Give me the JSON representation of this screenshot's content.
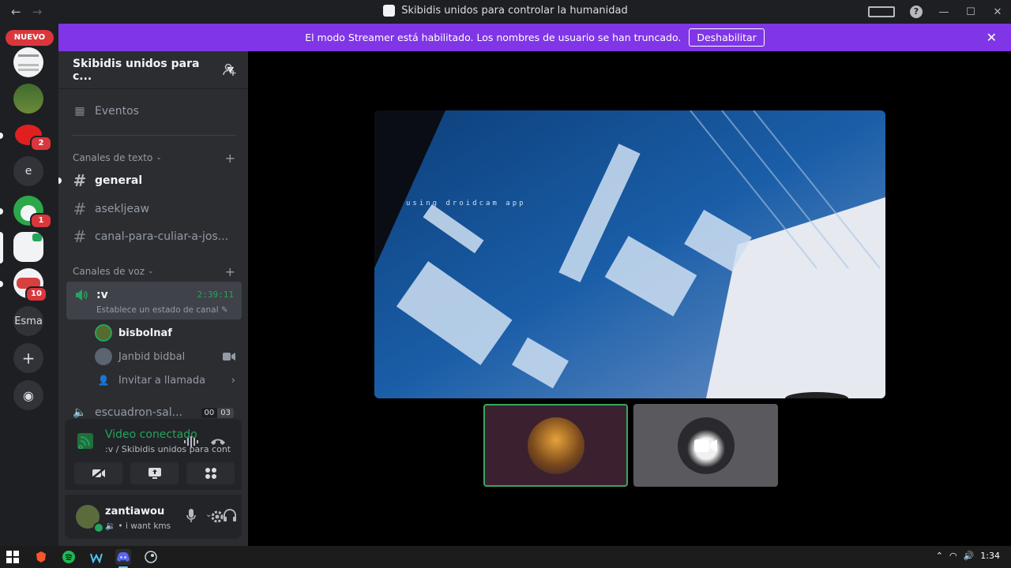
{
  "window": {
    "title": "Skibidis unidos para controlar la humanidad"
  },
  "banner": {
    "message": "El modo Streamer está habilitado. Los nombres de usuario se han truncado.",
    "button": "Deshabilitar"
  },
  "guilds": {
    "new_label": "NUEVO",
    "badges": [
      "2",
      "1",
      "10"
    ],
    "text_servers": [
      "e",
      "Esma"
    ]
  },
  "server": {
    "name": "Skibidis unidos para c...",
    "events_label": "Eventos",
    "text_category": "Canales de texto",
    "voice_category": "Canales de voz",
    "text_channels": [
      "general",
      "asekljeaw",
      "canal-para-culiar-a-jos..."
    ],
    "voice_channel": {
      "name": ":v",
      "timer": "2:39:11",
      "status": "Establece un estado de canal"
    },
    "members": [
      "bisbolnaf",
      "Janbid bidbal"
    ],
    "invite_label": "Invitar a llamada",
    "other_voice": {
      "name": "escuadron-sal...",
      "count_a": "00",
      "count_b": "03"
    }
  },
  "connection": {
    "title": "Video conectado",
    "subtitle": ":v / Skibidis unidos para contro..."
  },
  "user": {
    "name": "zantiawou",
    "status": "i want kms"
  },
  "video": {
    "watermark": "using droidcam app"
  },
  "taskbar": {
    "time": "1:34"
  },
  "colors": {
    "banner": "#8036e6",
    "connected": "#23a55a",
    "badge": "#da373c"
  }
}
